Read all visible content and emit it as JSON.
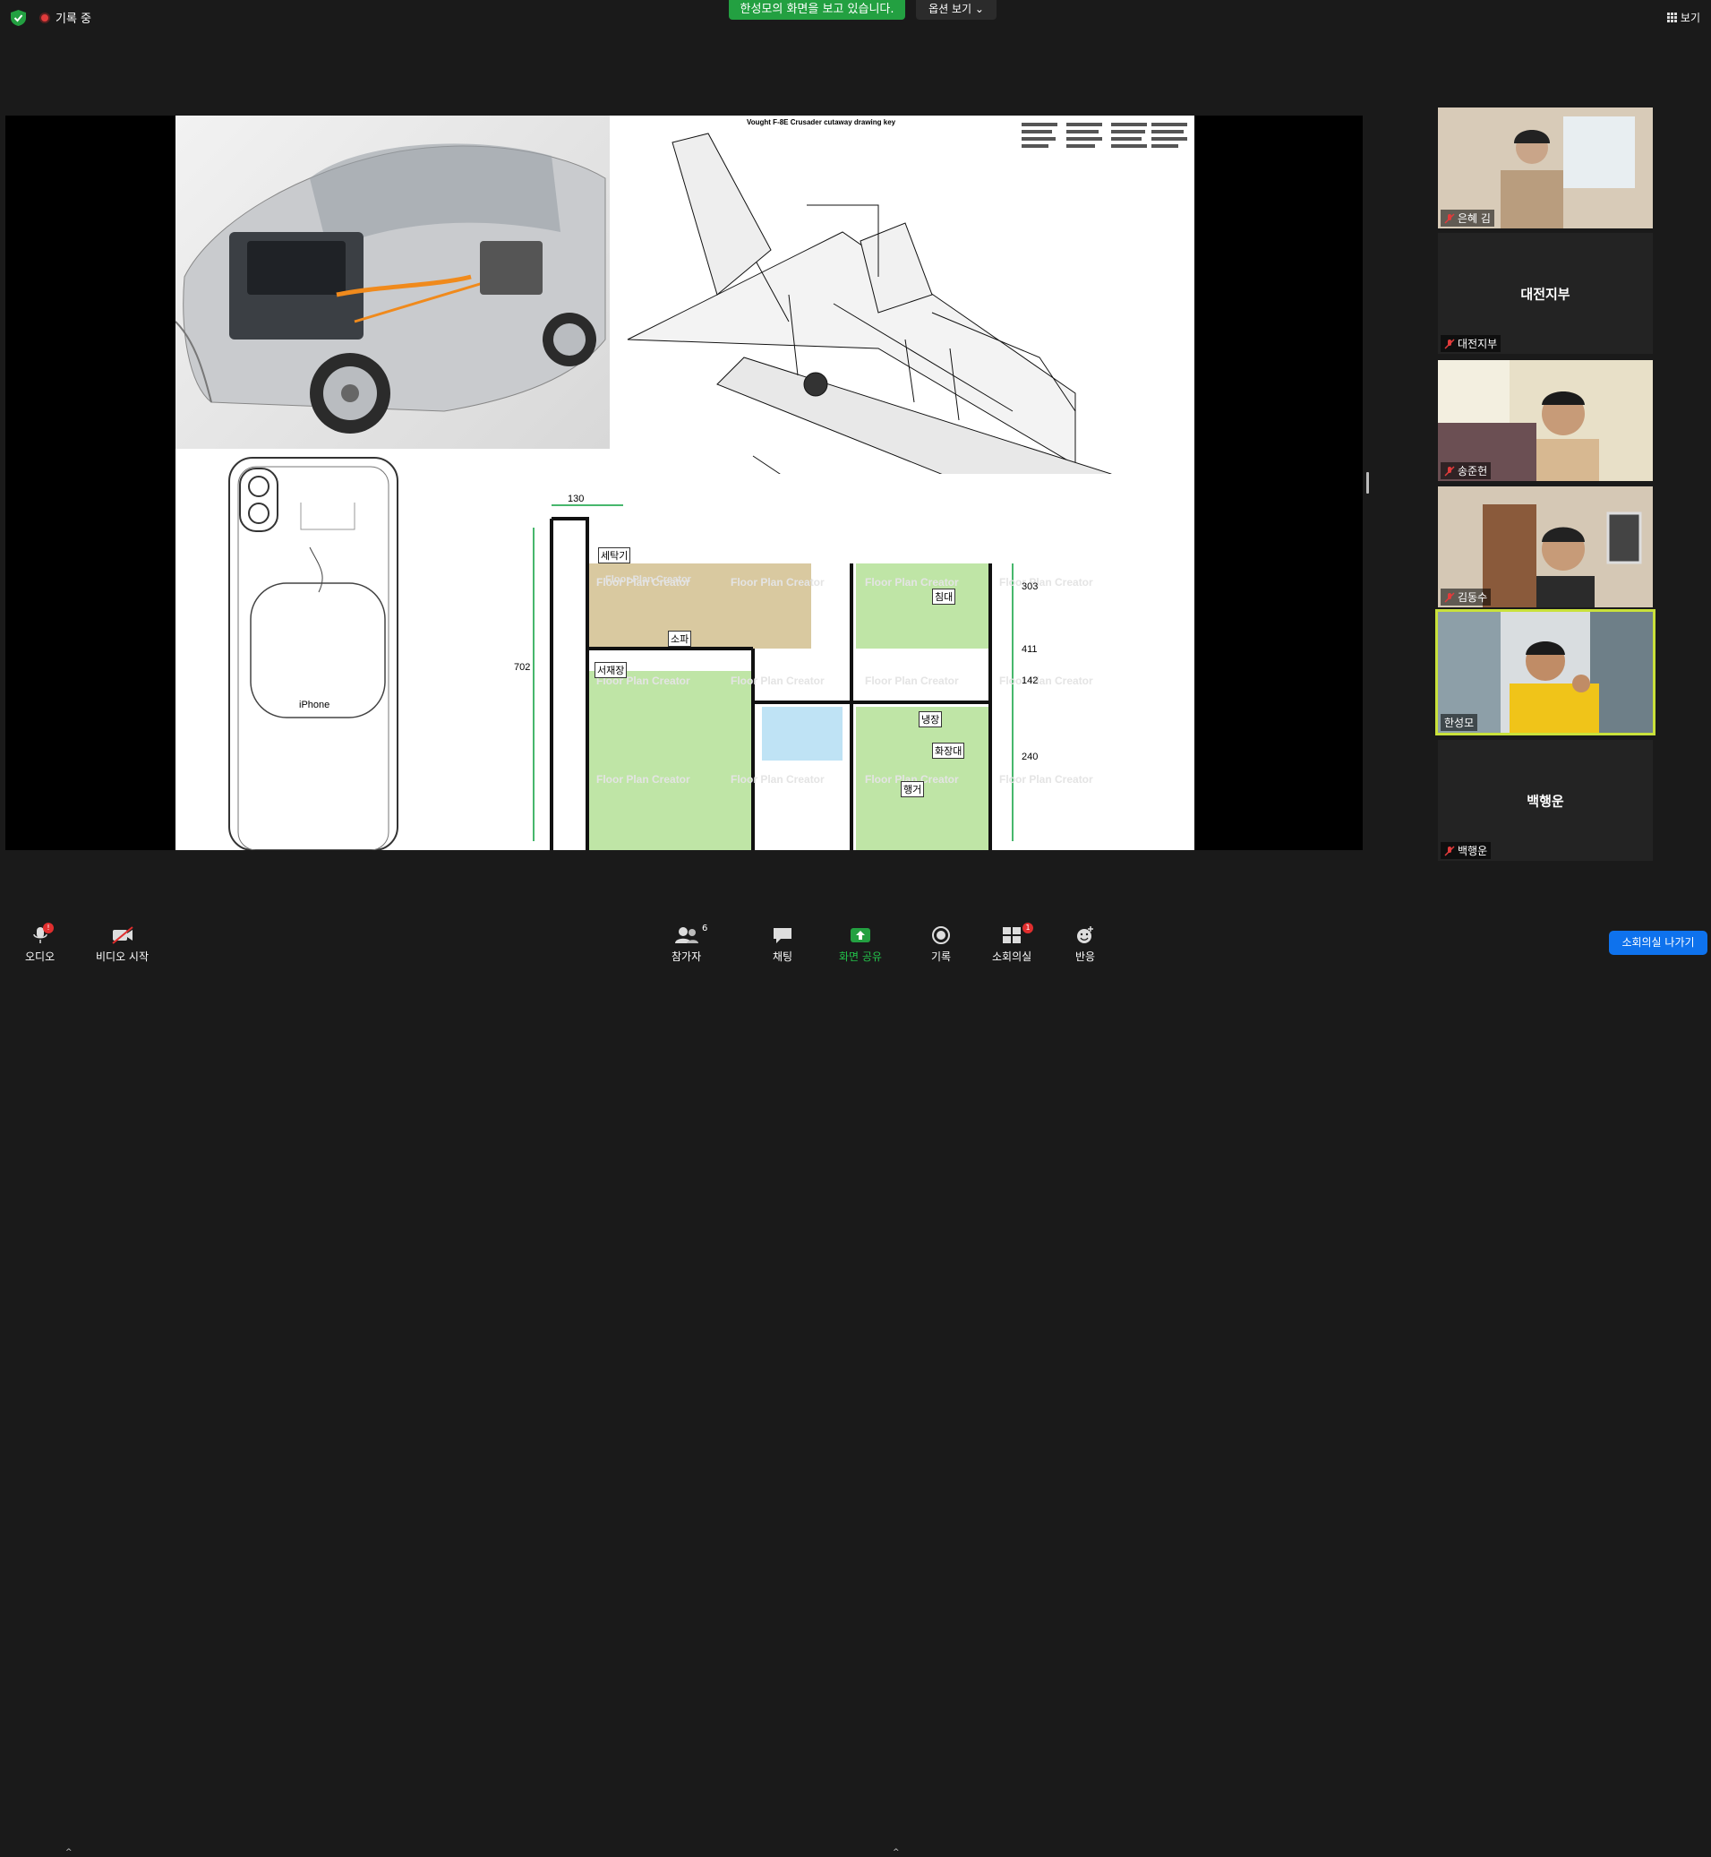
{
  "top": {
    "recording_label": "기록 중",
    "share_banner": "한성모의 화면을 보고 있습니다.",
    "view_options_label": "옵션 보기",
    "view_label": "보기"
  },
  "shared_screen": {
    "jet_key_title": "Vought F-8E Crusader cutaway drawing key",
    "plan_dims": [
      "130",
      "702",
      "303",
      "411",
      "142",
      "240"
    ],
    "plan_rooms": [
      "세탁기",
      "소파",
      "서재장",
      "침대",
      "냉장",
      "화장대",
      "행거"
    ],
    "plan_watermark": "Floor Plan Creator",
    "phone_label": "iPhone"
  },
  "participants": [
    {
      "name": "은혜 김",
      "display": "",
      "video": true
    },
    {
      "name": "대전지부",
      "display": "대전지부",
      "video": false
    },
    {
      "name": "송준헌",
      "display": "",
      "video": true
    },
    {
      "name": "김동수",
      "display": "",
      "video": true
    },
    {
      "name": "한성모",
      "display": "",
      "video": true,
      "active": true
    },
    {
      "name": "백행운",
      "display": "백행운",
      "video": false
    }
  ],
  "toolbar": {
    "audio": "오디오",
    "audio_badge": "!",
    "video": "비디오 시작",
    "participants": "참가자",
    "participants_count": "6",
    "chat": "채팅",
    "share": "화면 공유",
    "record": "기록",
    "breakout": "소회의실",
    "breakout_badge": "1",
    "reactions": "반응",
    "leave": "소회의실 나가기"
  },
  "colors": {
    "share_green": "#23a041",
    "leave_blue": "#0e72ed",
    "active_outline": "#c9e13b",
    "badge_red": "#e02e2e"
  }
}
